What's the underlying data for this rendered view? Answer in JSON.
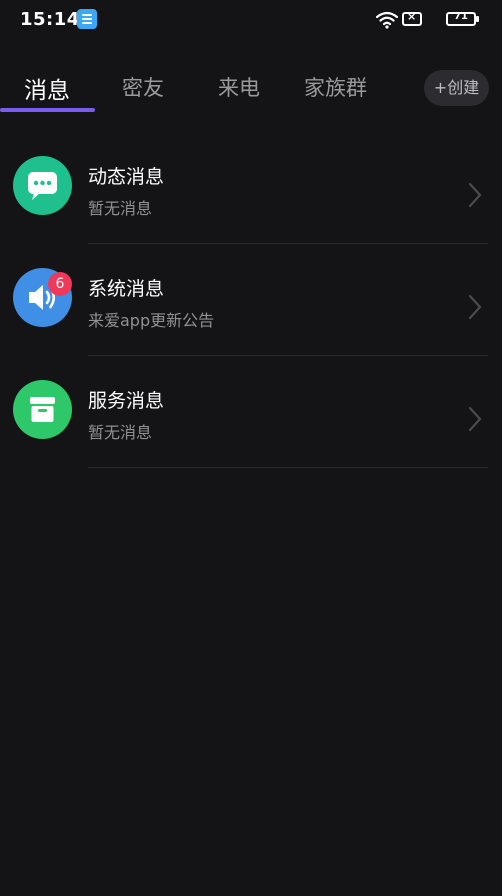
{
  "status_bar": {
    "time": "15:14",
    "battery_level": "71",
    "sim_label": "×"
  },
  "tabs": [
    {
      "label": "消息",
      "active": true
    },
    {
      "label": "密友",
      "active": false
    },
    {
      "label": "来电",
      "active": false
    },
    {
      "label": "家族群",
      "active": false
    }
  ],
  "create_button": {
    "label": "+创建"
  },
  "messages": [
    {
      "title": "动态消息",
      "subtitle": "暂无消息",
      "icon": "chat-bubble-icon",
      "color": "#1fc08e"
    },
    {
      "title": "系统消息",
      "subtitle": "来爱app更新公告",
      "icon": "speaker-icon",
      "color": "#3f8fe6",
      "badge": "6"
    },
    {
      "title": "服务消息",
      "subtitle": "暂无消息",
      "icon": "box-icon",
      "color": "#2ec86a"
    }
  ],
  "colors": {
    "background": "#141416",
    "accent": "#7b5cf0",
    "badge": "#f0385b"
  }
}
